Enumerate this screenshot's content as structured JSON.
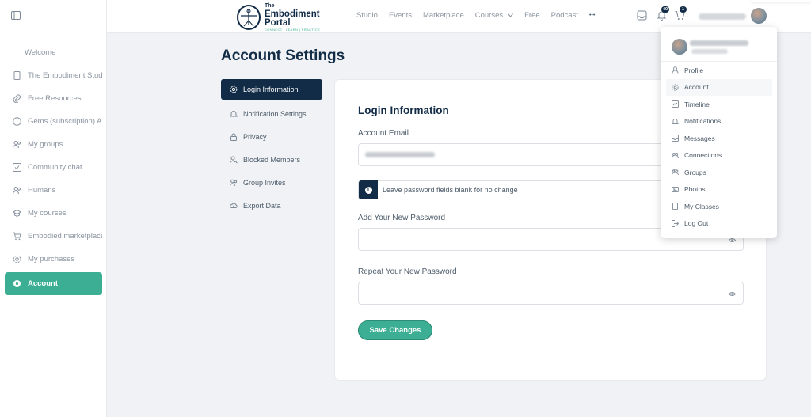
{
  "sidebar": {
    "items": [
      {
        "label": "Welcome",
        "icon": "none"
      },
      {
        "label": "The Embodiment Studio",
        "icon": "page-icon"
      },
      {
        "label": "Free Resources",
        "icon": "paperclip-icon"
      },
      {
        "label": "Gems (subscription) A...",
        "icon": "circle-icon"
      },
      {
        "label": "My groups",
        "icon": "users-icon"
      },
      {
        "label": "Community chat",
        "icon": "chat-icon"
      },
      {
        "label": "Humans",
        "icon": "users-icon"
      },
      {
        "label": "My courses",
        "icon": "graduation-cap-icon"
      },
      {
        "label": "Embodied marketplace",
        "icon": "cart-icon"
      },
      {
        "label": "My purchases",
        "icon": "gear-icon"
      },
      {
        "label": "Account",
        "icon": "gear-icon"
      }
    ]
  },
  "header": {
    "logo": {
      "the": "The",
      "line1": "Embodiment",
      "line2": "Portal",
      "tagline": "CONNECT | LEARN | PRACTICE"
    },
    "nav": [
      "Studio",
      "Events",
      "Marketplace",
      "Courses",
      "Free",
      "Podcast",
      "•••"
    ],
    "notifications_count": "40",
    "cart_count": "1"
  },
  "page": {
    "title": "Account Settings",
    "subnav": [
      "Login Information",
      "Notification Settings",
      "Privacy",
      "Blocked Members",
      "Group Invites",
      "Export Data"
    ]
  },
  "form": {
    "title": "Login Information",
    "email_label": "Account Email",
    "notice": "Leave password fields blank for no change",
    "new_password_label": "Add Your New Password",
    "repeat_password_label": "Repeat Your New Password",
    "save_label": "Save Changes"
  },
  "dropdown": {
    "items": [
      "Profile",
      "Account",
      "Timeline",
      "Notifications",
      "Messages",
      "Connections",
      "Groups",
      "Photos",
      "My Classes",
      "Log Out"
    ]
  },
  "colors": {
    "accent": "#3cae93",
    "navy": "#122b46",
    "text": "#4b5a69",
    "muted": "#8a94a0"
  }
}
